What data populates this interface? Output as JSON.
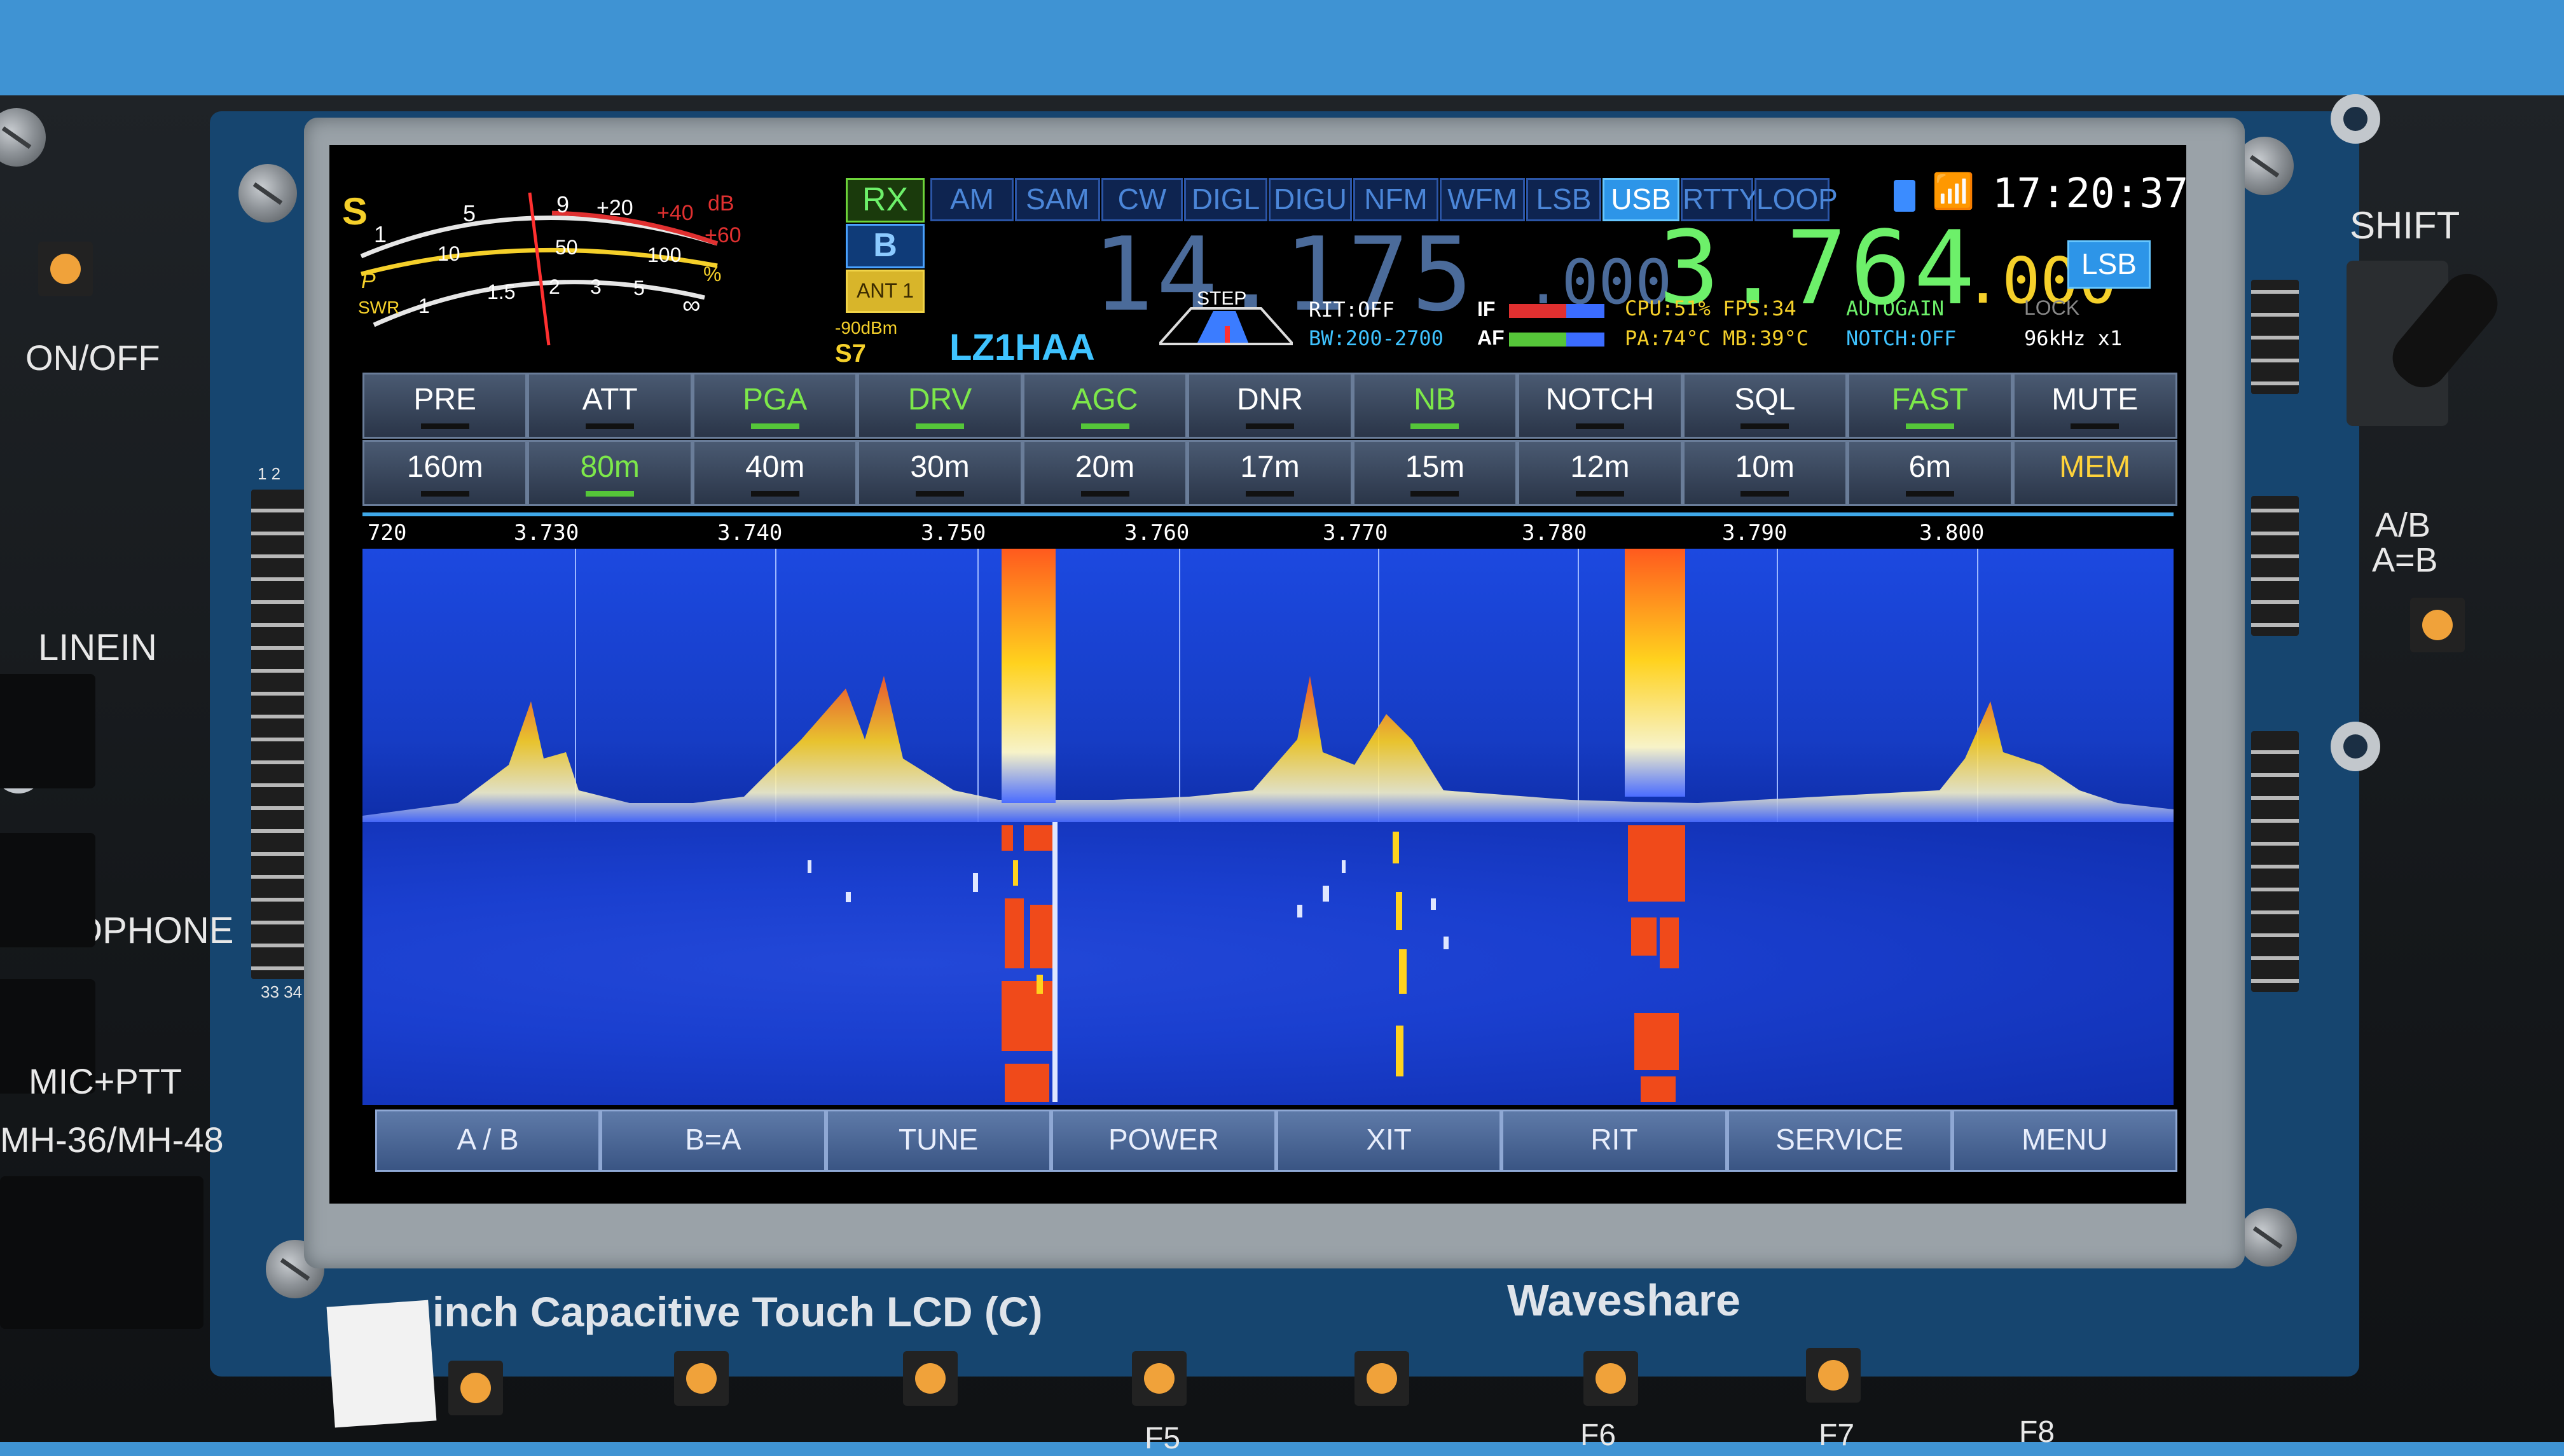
{
  "board": {
    "on_off": "ON/OFF",
    "line_in": "LINEIN",
    "headphone": "HEADPHONE",
    "mic_ptt": "MIC+PTT",
    "mic_model": "MH-36/MH-48",
    "shift": "SHIFT",
    "ab": "A/B",
    "a_eq_b": "A=B",
    "lcd_label": "inch Capacitive Touch LCD (C)",
    "brand": "Waveshare",
    "fkeys": [
      "F5",
      "F6",
      "F7",
      "F8"
    ],
    "pin_start": "1 2",
    "pin_end": "33 34"
  },
  "screen": {
    "meter": {
      "s_letter": "S",
      "s_scale": [
        "1",
        "5",
        "9",
        "+20",
        "+40",
        "+60"
      ],
      "db": "dB",
      "p_scale": [
        "10",
        "50",
        "100"
      ],
      "p_letter": "P",
      "pct": "%",
      "swr_label": "SWR",
      "swr_scale": [
        "1",
        "1.5",
        "2",
        "3",
        "5",
        "∞"
      ],
      "dbm": "-90dBm",
      "s_reading": "S7"
    },
    "rx": "RX",
    "vfo": "B",
    "ant": "ANT 1",
    "callsign": "LZ1HAA",
    "modes": [
      "AM",
      "SAM",
      "CW",
      "DIGL",
      "DIGU",
      "NFM",
      "WFM",
      "LSB",
      "USB",
      "RTTY",
      "LOOP"
    ],
    "active_mode": "USB",
    "clock": "17:20:37",
    "freq_inactive_main": "14.175",
    "freq_inactive_sub": ".000",
    "freq_active_main": "3.764",
    "freq_active_sub": ".000",
    "active_mode_badge": "LSB",
    "step_label": "STEP",
    "rit": "RIT:OFF",
    "bw": "BW:200-2700",
    "if_label": "IF",
    "af_label": "AF",
    "cpu_fps": "CPU:51% FPS:34",
    "pa_mb": "PA:74°C MB:39°C",
    "autogain": "AUTOGAIN",
    "notch": "NOTCH:OFF",
    "lock": "LOCK",
    "sample": "96kHz x1",
    "func_row": [
      {
        "label": "PRE",
        "state": "off"
      },
      {
        "label": "ATT",
        "state": "off"
      },
      {
        "label": "PGA",
        "state": "on"
      },
      {
        "label": "DRV",
        "state": "on"
      },
      {
        "label": "AGC",
        "state": "on"
      },
      {
        "label": "DNR",
        "state": "off"
      },
      {
        "label": "NB",
        "state": "on"
      },
      {
        "label": "NOTCH",
        "state": "off"
      },
      {
        "label": "SQL",
        "state": "off"
      },
      {
        "label": "FAST",
        "state": "on"
      },
      {
        "label": "MUTE",
        "state": "off"
      }
    ],
    "band_row": [
      {
        "label": "160m",
        "state": "off"
      },
      {
        "label": "80m",
        "state": "on"
      },
      {
        "label": "40m",
        "state": "off"
      },
      {
        "label": "30m",
        "state": "off"
      },
      {
        "label": "20m",
        "state": "off"
      },
      {
        "label": "17m",
        "state": "off"
      },
      {
        "label": "15m",
        "state": "off"
      },
      {
        "label": "12m",
        "state": "off"
      },
      {
        "label": "10m",
        "state": "off"
      },
      {
        "label": "6m",
        "state": "off"
      },
      {
        "label": "MEM",
        "state": "mem"
      }
    ],
    "scale": [
      "720",
      "3.730",
      "3.740",
      "3.750",
      "3.760",
      "3.770",
      "3.780",
      "3.790",
      "3.800"
    ],
    "bottom_buttons": [
      "A / B",
      "B=A",
      "TUNE",
      "POWER",
      "XIT",
      "RIT",
      "SERVICE",
      "MENU"
    ]
  },
  "colors": {
    "accent_green": "#55c639",
    "active_freq": "#6df06a",
    "freq_dim": "#4b6b9a",
    "mem_yellow": "#ffd33a",
    "usb_active": "#2d95e8",
    "waterfall_blue": "#1a3fcf"
  }
}
